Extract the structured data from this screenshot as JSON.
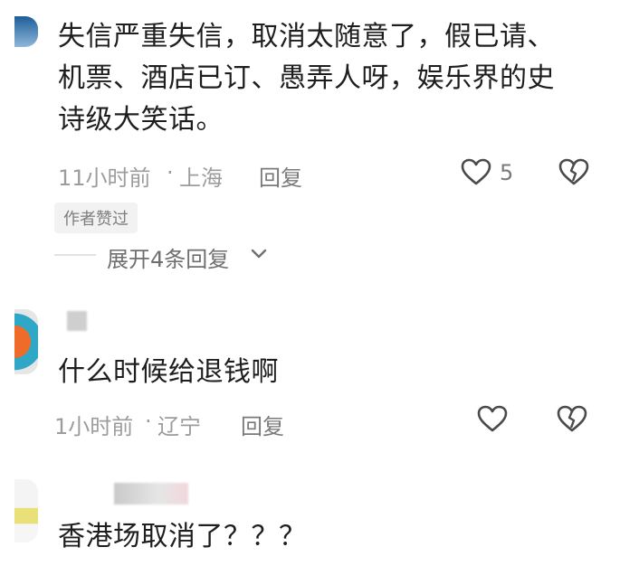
{
  "comments": [
    {
      "username": "",
      "text_lines": [
        "失信严重失信，取消太随意了，假已请、",
        "机票、酒店已订、愚弄人呀，娱乐界的史",
        "诗级大笑话。"
      ],
      "time": "11小时前",
      "location": "上海",
      "reply_label": "回复",
      "likes": "5",
      "author_badge": "作者赞过",
      "expand_label": "展开4条回复"
    },
    {
      "username": "",
      "text": "什么时候给退钱啊",
      "time": "1小时前",
      "location": "辽宁",
      "reply_label": "回复"
    },
    {
      "username": "",
      "text": "香港场取消了？？？"
    }
  ],
  "icons": {
    "like": "heart-outline-icon",
    "dislike": "broken-heart-icon",
    "expand": "chevron-down-icon"
  },
  "colors": {
    "icon": "#4a4a4a",
    "meta": "#9c9c9c"
  }
}
